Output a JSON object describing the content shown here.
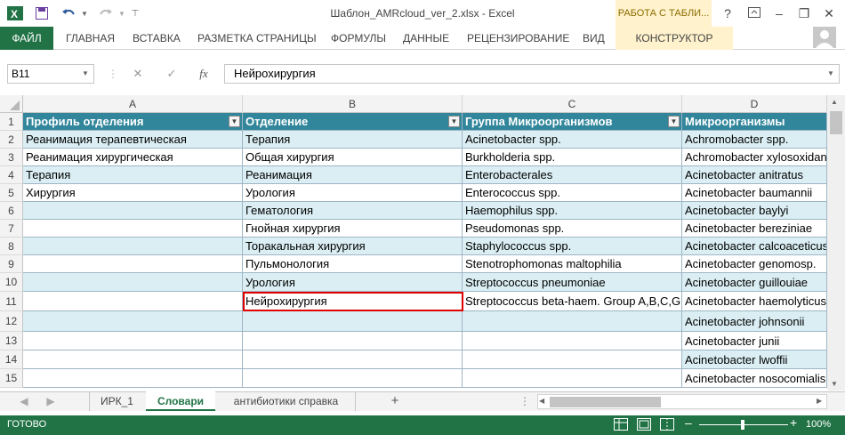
{
  "window": {
    "title": "Шаблон_AMRcloud_ver_2.xlsx - Excel",
    "context_tab_group": "РАБОТА С ТАБЛИ...",
    "help": "?",
    "minimize": "–",
    "restore": "❐",
    "close": "✕"
  },
  "ribbon": {
    "tabs": [
      "ФАЙЛ",
      "ГЛАВНАЯ",
      "ВСТАВКА",
      "РАЗМЕТКА СТРАНИЦЫ",
      "ФОРМУЛЫ",
      "ДАННЫЕ",
      "РЕЦЕНЗИРОВАНИЕ",
      "ВИД"
    ],
    "context_tab": "КОНСТРУКТОР"
  },
  "formula_bar": {
    "name_box": "B11",
    "fx": "fx",
    "formula": "Нейрохирургия"
  },
  "columns": [
    "A",
    "B",
    "C",
    "D"
  ],
  "rows": [
    [
      "Профиль отделения",
      "Отделение",
      "Группа Микроорганизмов",
      "Микроорганизмы"
    ],
    [
      "Реанимация терапевтическая",
      "Терапия",
      "Acinetobacter spp.",
      "Achromobacter spp."
    ],
    [
      "Реанимация хирургическая",
      "Общая хирургия",
      "Burkholderia spp.",
      "Achromobacter xylosoxidans"
    ],
    [
      "Терапия",
      "Реанимация",
      "Enterobacterales",
      "Acinetobacter anitratus"
    ],
    [
      "Хирургия",
      "Урология",
      "Enterococcus spp.",
      "Acinetobacter baumannii"
    ],
    [
      "",
      "Гематология",
      "Haemophilus spp.",
      "Acinetobacter baylyi"
    ],
    [
      "",
      "Гнойная хирургия",
      "Pseudomonas spp.",
      "Acinetobacter bereziniae"
    ],
    [
      "",
      "Торакальная хирургия",
      "Staphylococcus spp.",
      "Acinetobacter calcoaceticus"
    ],
    [
      "",
      "Пульмонология",
      "Stenotrophomonas maltophilia",
      "Acinetobacter genomosp."
    ],
    [
      "",
      "Урология",
      "Streptococcus pneumoniae",
      "Acinetobacter guillouiae"
    ],
    [
      "",
      "Нейрохирургия",
      "Streptococcus beta-haem. Group A,B,C,G",
      "Acinetobacter haemolyticus"
    ],
    [
      "",
      "",
      "",
      "Acinetobacter johnsonii"
    ],
    [
      "",
      "",
      "",
      "Acinetobacter junii"
    ],
    [
      "",
      "",
      "",
      "Acinetobacter lwoffii"
    ],
    [
      "",
      "",
      "",
      "Acinetobacter nosocomialis"
    ]
  ],
  "row_numbers": [
    "1",
    "2",
    "3",
    "4",
    "5",
    "6",
    "7",
    "8",
    "9",
    "10",
    "11",
    "12",
    "13",
    "14",
    "15"
  ],
  "sheets": {
    "tabs": [
      "ИРК_1",
      "Словари",
      "антибиотики справка"
    ],
    "active": "Словари",
    "add": "+"
  },
  "status_bar": {
    "ready": "ГОТОВО",
    "zoom": "100%",
    "zoom_minus": "–",
    "zoom_plus": "+"
  },
  "colors": {
    "excel_green": "#217346",
    "header_fill": "#31869b",
    "band_fill": "#daeef3",
    "context_tab": "#fff2cc",
    "selection": "#e00000"
  }
}
